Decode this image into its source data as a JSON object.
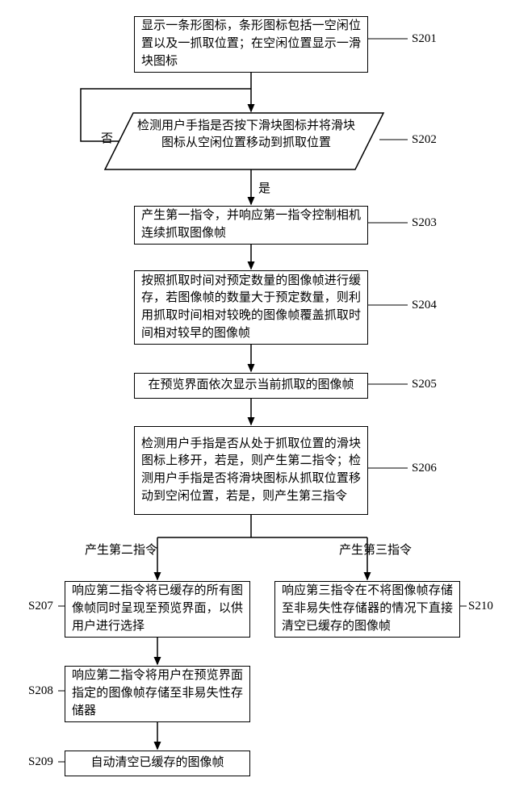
{
  "chart_data": {
    "type": "flowchart",
    "nodes": [
      {
        "id": "S201",
        "text": "显示一条形图标，条形图标包括一空闲位置以及一抓取位置；在空闲位置显示一滑块图标",
        "shape": "rect"
      },
      {
        "id": "S202",
        "text": "检测用户手指是否按下滑块图标并将滑块图标从空闲位置移动到抓取位置",
        "shape": "parallelogram"
      },
      {
        "id": "S203",
        "text": "产生第一指令，并响应第一指令控制相机连续抓取图像帧",
        "shape": "rect"
      },
      {
        "id": "S204",
        "text": "按照抓取时间对预定数量的图像帧进行缓存，若图像帧的数量大于预定数量，则利用抓取时间相对较晚的图像帧覆盖抓取时间相对较早的图像帧",
        "shape": "rect"
      },
      {
        "id": "S205",
        "text": "在预览界面依次显示当前抓取的图像帧",
        "shape": "rect"
      },
      {
        "id": "S206",
        "text": "检测用户手指是否从处于抓取位置的滑块图标上移开，若是，则产生第二指令；检测用户手指是否将滑块图标从抓取位置移动到空闲位置，若是，则产生第三指令",
        "shape": "rect"
      },
      {
        "id": "S207",
        "text": "响应第二指令将已缓存的所有图像帧同时呈现至预览界面，以供用户进行选择",
        "shape": "rect"
      },
      {
        "id": "S208",
        "text": "响应第二指令将用户在预览界面指定的图像帧存储至非易失性存储器",
        "shape": "rect"
      },
      {
        "id": "S209",
        "text": "自动清空已缓存的图像帧",
        "shape": "rect"
      },
      {
        "id": "S210",
        "text": "响应第三指令在不将图像帧存储至非易失性存储器的情况下直接清空已缓存的图像帧",
        "shape": "rect"
      }
    ],
    "edges": [
      {
        "from": "S201",
        "to": "S202",
        "label": ""
      },
      {
        "from": "S202",
        "to": "S203",
        "label": "是"
      },
      {
        "from": "S202",
        "to": "S201",
        "label": "否",
        "note": "loop back"
      },
      {
        "from": "S203",
        "to": "S204",
        "label": ""
      },
      {
        "from": "S204",
        "to": "S205",
        "label": ""
      },
      {
        "from": "S205",
        "to": "S206",
        "label": ""
      },
      {
        "from": "S206",
        "to": "S207",
        "label": "产生第二指令"
      },
      {
        "from": "S206",
        "to": "S210",
        "label": "产生第三指令"
      },
      {
        "from": "S207",
        "to": "S208",
        "label": ""
      },
      {
        "from": "S208",
        "to": "S209",
        "label": ""
      }
    ]
  },
  "nodes": {
    "s201": {
      "label": "S201",
      "text": "显示一条形图标，条形图标包括一空闲位置以及一抓取位置；在空闲位置显示一滑块图标"
    },
    "s202": {
      "label": "S202",
      "text": "检测用户手指是否按下滑块图标并将滑块图标从空闲位置移动到抓取位置"
    },
    "s203": {
      "label": "S203",
      "text": "产生第一指令，并响应第一指令控制相机连续抓取图像帧"
    },
    "s204": {
      "label": "S204",
      "text": "按照抓取时间对预定数量的图像帧进行缓存，若图像帧的数量大于预定数量，则利用抓取时间相对较晚的图像帧覆盖抓取时间相对较早的图像帧"
    },
    "s205": {
      "label": "S205",
      "text": "在预览界面依次显示当前抓取的图像帧"
    },
    "s206": {
      "label": "S206",
      "text": "检测用户手指是否从处于抓取位置的滑块图标上移开，若是，则产生第二指令；检测用户手指是否将滑块图标从抓取位置移动到空闲位置，若是，则产生第三指令"
    },
    "s207": {
      "label": "S207",
      "text": "响应第二指令将已缓存的所有图像帧同时呈现至预览界面，以供用户进行选择"
    },
    "s208": {
      "label": "S208",
      "text": "响应第二指令将用户在预览界面指定的图像帧存储至非易失性存储器"
    },
    "s209": {
      "label": "S209",
      "text": "自动清空已缓存的图像帧"
    },
    "s210": {
      "label": "S210",
      "text": "响应第三指令在不将图像帧存储至非易失性存储器的情况下直接清空已缓存的图像帧"
    }
  },
  "edge_labels": {
    "yes": "是",
    "no": "否",
    "cmd2": "产生第二指令",
    "cmd3": "产生第三指令"
  }
}
